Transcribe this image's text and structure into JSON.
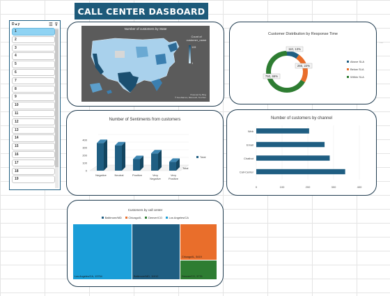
{
  "dashboard_title": "CALL CENTER DASBOARD",
  "slicer": {
    "header": "D▲y",
    "items": [
      "1",
      "2",
      "3",
      "4",
      "5",
      "6",
      "7",
      "8",
      "9",
      "10",
      "11",
      "12",
      "13",
      "14",
      "15",
      "16",
      "17",
      "18",
      "19"
    ],
    "selected_index": 0
  },
  "map_chart": {
    "title": "Number of customers by State",
    "legend_title": "Count of customer_name",
    "legend_max": "115",
    "legend_min": "1",
    "attribution": "Powered by Bing\n© GeoNames, Microsoft, TomTom"
  },
  "donut_chart": {
    "title": "Customer Distribution by Response Time",
    "slices": [
      {
        "label": "Above SLA",
        "display": "110, 13%",
        "value": 110,
        "color": "#1f5e82"
      },
      {
        "label": "Below SLA",
        "display": "266, 22%",
        "value": 266,
        "color": "#e96e2b"
      },
      {
        "label": "Within SLA",
        "display": "750, 66%",
        "value": 750,
        "color": "#2e7d32"
      }
    ],
    "legend": [
      "Above SLA",
      "Below SLA",
      "Within SLA"
    ]
  },
  "sentiment_chart": {
    "title": "Number of Sentiments from customers",
    "categories": [
      "Negative",
      "Neutral",
      "Positive",
      "Very Negative",
      "Very Positive"
    ],
    "values": [
      360,
      330,
      150,
      225,
      115
    ],
    "y_ticks": [
      "0",
      "100",
      "200",
      "300",
      "400"
    ],
    "legend": "Total",
    "axis_label": "Total"
  },
  "channel_chart": {
    "title": "Number of customers by channel",
    "categories": [
      "Web",
      "Email",
      "Chatbot",
      "Call-Center"
    ],
    "values": [
      205,
      265,
      285,
      345
    ],
    "x_ticks": [
      "0",
      "100",
      "200",
      "300",
      "400"
    ]
  },
  "treemap": {
    "title": "Customers by call center",
    "legend": [
      "Baltimore/MD",
      "Chicago/IL",
      "Denver/CO",
      "Los Angeles/CA"
    ],
    "tiles": [
      {
        "label": "Los Angeles/CA, 13754",
        "color": "#1a9ed8"
      },
      {
        "label": "Baltimore/MD, 11012",
        "color": "#1f5e82"
      },
      {
        "label": "Chicago/IL, 5419",
        "color": "#e96e2b"
      },
      {
        "label": "Denver/CO, 3776",
        "color": "#2e7d32"
      }
    ]
  },
  "chart_data": [
    {
      "type": "bar",
      "title": "Number of Sentiments from customers",
      "categories": [
        "Negative",
        "Neutral",
        "Positive",
        "Very Negative",
        "Very Positive"
      ],
      "values": [
        360,
        330,
        150,
        225,
        115
      ],
      "ylim": [
        0,
        400
      ],
      "legend": "Total"
    },
    {
      "type": "bar",
      "title": "Number of customers by channel",
      "categories": [
        "Web",
        "Email",
        "Chatbot",
        "Call-Center"
      ],
      "values": [
        205,
        265,
        285,
        345
      ],
      "xlim": [
        0,
        400
      ]
    },
    {
      "type": "pie",
      "title": "Customer Distribution by Response Time",
      "categories": [
        "Above SLA",
        "Below SLA",
        "Within SLA"
      ],
      "values": [
        110,
        266,
        750
      ]
    },
    {
      "type": "heatmap",
      "title": "Customers by call center",
      "categories": [
        "Los Angeles/CA",
        "Baltimore/MD",
        "Chicago/IL",
        "Denver/CO"
      ],
      "values": [
        13754,
        11012,
        5419,
        3776
      ]
    }
  ]
}
